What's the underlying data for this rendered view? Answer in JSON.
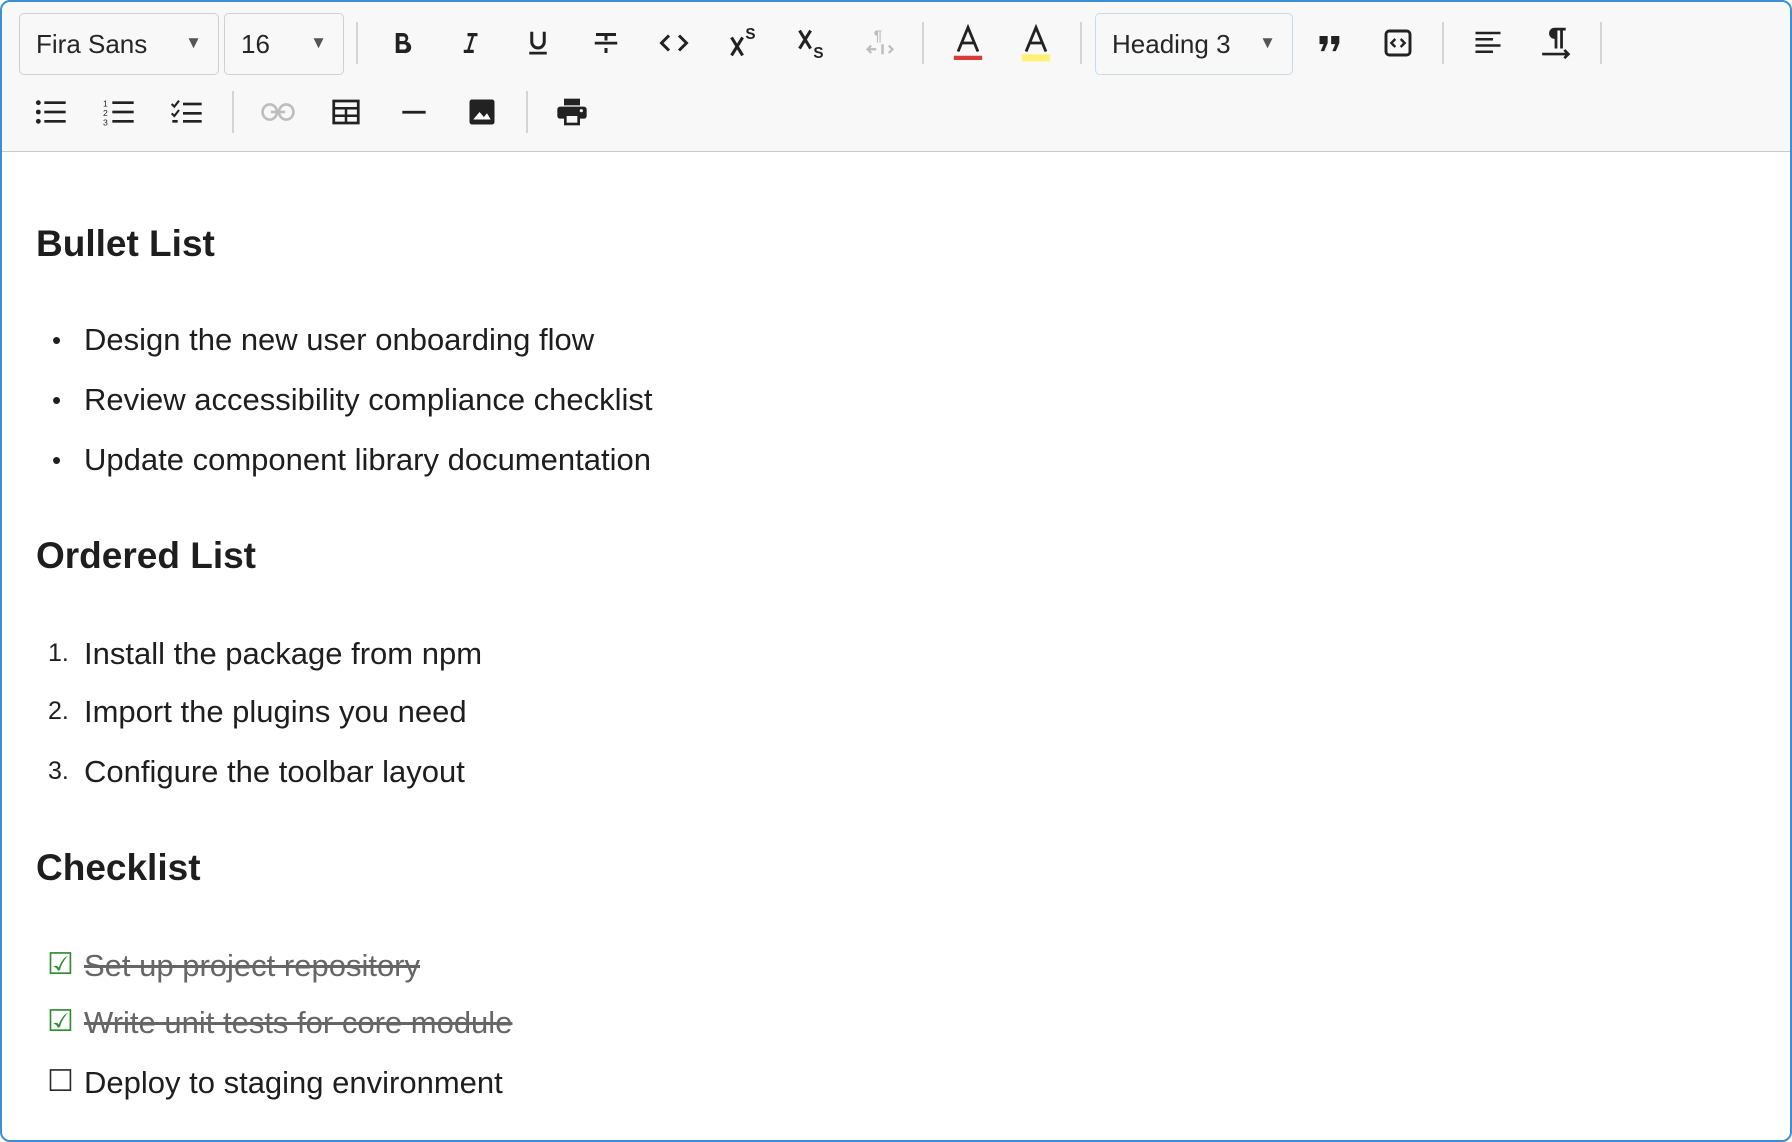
{
  "toolbar": {
    "font_family": "Fira Sans",
    "font_size": "16",
    "block_style": "Heading 3",
    "text_color": "#d93b3b",
    "highlight_color": "#fff176"
  },
  "content": {
    "sections": [
      {
        "heading": "Bullet List",
        "items": [
          "Design the new user onboarding flow",
          "Review accessibility compliance checklist",
          "Update component library documentation"
        ]
      },
      {
        "heading": "Ordered List",
        "items": [
          {
            "marker": "1.",
            "text": "Install the package from npm"
          },
          {
            "marker": "2.",
            "text": "Import the plugins you need"
          },
          {
            "marker": "3.",
            "text": "Configure the toolbar layout"
          }
        ]
      },
      {
        "heading": "Checklist",
        "items": [
          {
            "checked": true,
            "text": "Set up project repository"
          },
          {
            "checked": true,
            "text": "Write unit tests for core module"
          },
          {
            "checked": false,
            "text": "Deploy to staging environment"
          }
        ]
      }
    ]
  }
}
